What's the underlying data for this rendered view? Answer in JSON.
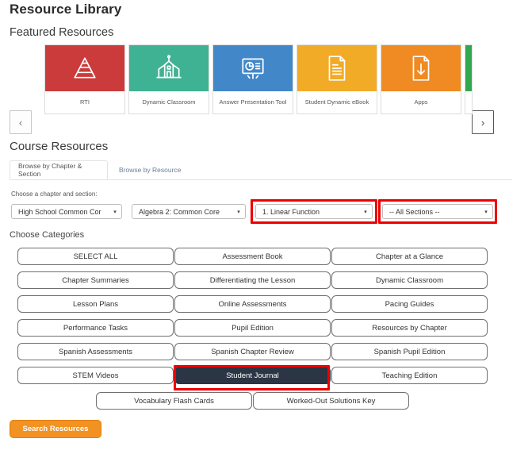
{
  "page_title": "Resource Library",
  "featured": {
    "heading": "Featured Resources",
    "prev_label": "‹",
    "next_label": "›",
    "cards": [
      {
        "label": "RTI",
        "color": "#cc3b3b",
        "icon": "pyramid-icon"
      },
      {
        "label": "Dynamic Classroom",
        "color": "#3fb293",
        "icon": "schoolhouse-icon"
      },
      {
        "label": "Answer Presentation Tool",
        "color": "#4287c8",
        "icon": "presentation-board-icon"
      },
      {
        "label": "Student Dynamic eBook",
        "color": "#f2ab27",
        "icon": "document-lines-icon"
      },
      {
        "label": "Apps",
        "color": "#ef8b22",
        "icon": "document-download-icon"
      }
    ],
    "partial_card_color": "#2fa84f"
  },
  "course_resources": {
    "heading": "Course Resources",
    "tabs": [
      {
        "label": "Browse by Chapter & Section",
        "active": true
      },
      {
        "label": "Browse by Resource",
        "active": false
      }
    ],
    "chooser_label": "Choose a chapter and section:",
    "selects": [
      {
        "name": "program",
        "value": "High School Common Cor"
      },
      {
        "name": "course",
        "value": "Algebra 2: Common Core"
      },
      {
        "name": "chapter",
        "value": "1. Linear Function"
      },
      {
        "name": "section",
        "value": "-- All Sections --"
      }
    ],
    "caret": "▾",
    "highlight_color": "#ee0000",
    "categories_label": "Choose Categories",
    "categories": [
      {
        "label": "SELECT ALL",
        "selected": false
      },
      {
        "label": "Assessment Book",
        "selected": false
      },
      {
        "label": "Chapter at a Glance",
        "selected": false
      },
      {
        "label": "Chapter Summaries",
        "selected": false
      },
      {
        "label": "Differentiating the Lesson",
        "selected": false
      },
      {
        "label": "Dynamic Classroom",
        "selected": false
      },
      {
        "label": "Lesson Plans",
        "selected": false
      },
      {
        "label": "Online Assessments",
        "selected": false
      },
      {
        "label": "Pacing Guides",
        "selected": false
      },
      {
        "label": "Performance Tasks",
        "selected": false
      },
      {
        "label": "Pupil Edition",
        "selected": false
      },
      {
        "label": "Resources by Chapter",
        "selected": false
      },
      {
        "label": "Spanish Assessments",
        "selected": false
      },
      {
        "label": "Spanish Chapter Review",
        "selected": false
      },
      {
        "label": "Spanish Pupil Edition",
        "selected": false
      },
      {
        "label": "STEM Videos",
        "selected": false
      },
      {
        "label": "Student Journal",
        "selected": true
      },
      {
        "label": "Teaching Edition",
        "selected": false
      },
      {
        "label": "Vocabulary Flash Cards",
        "selected": false
      },
      {
        "label": "Worked-Out Solutions Key",
        "selected": false
      }
    ],
    "search_button_label": "Search Resources",
    "search_button_color": "#f29222"
  }
}
